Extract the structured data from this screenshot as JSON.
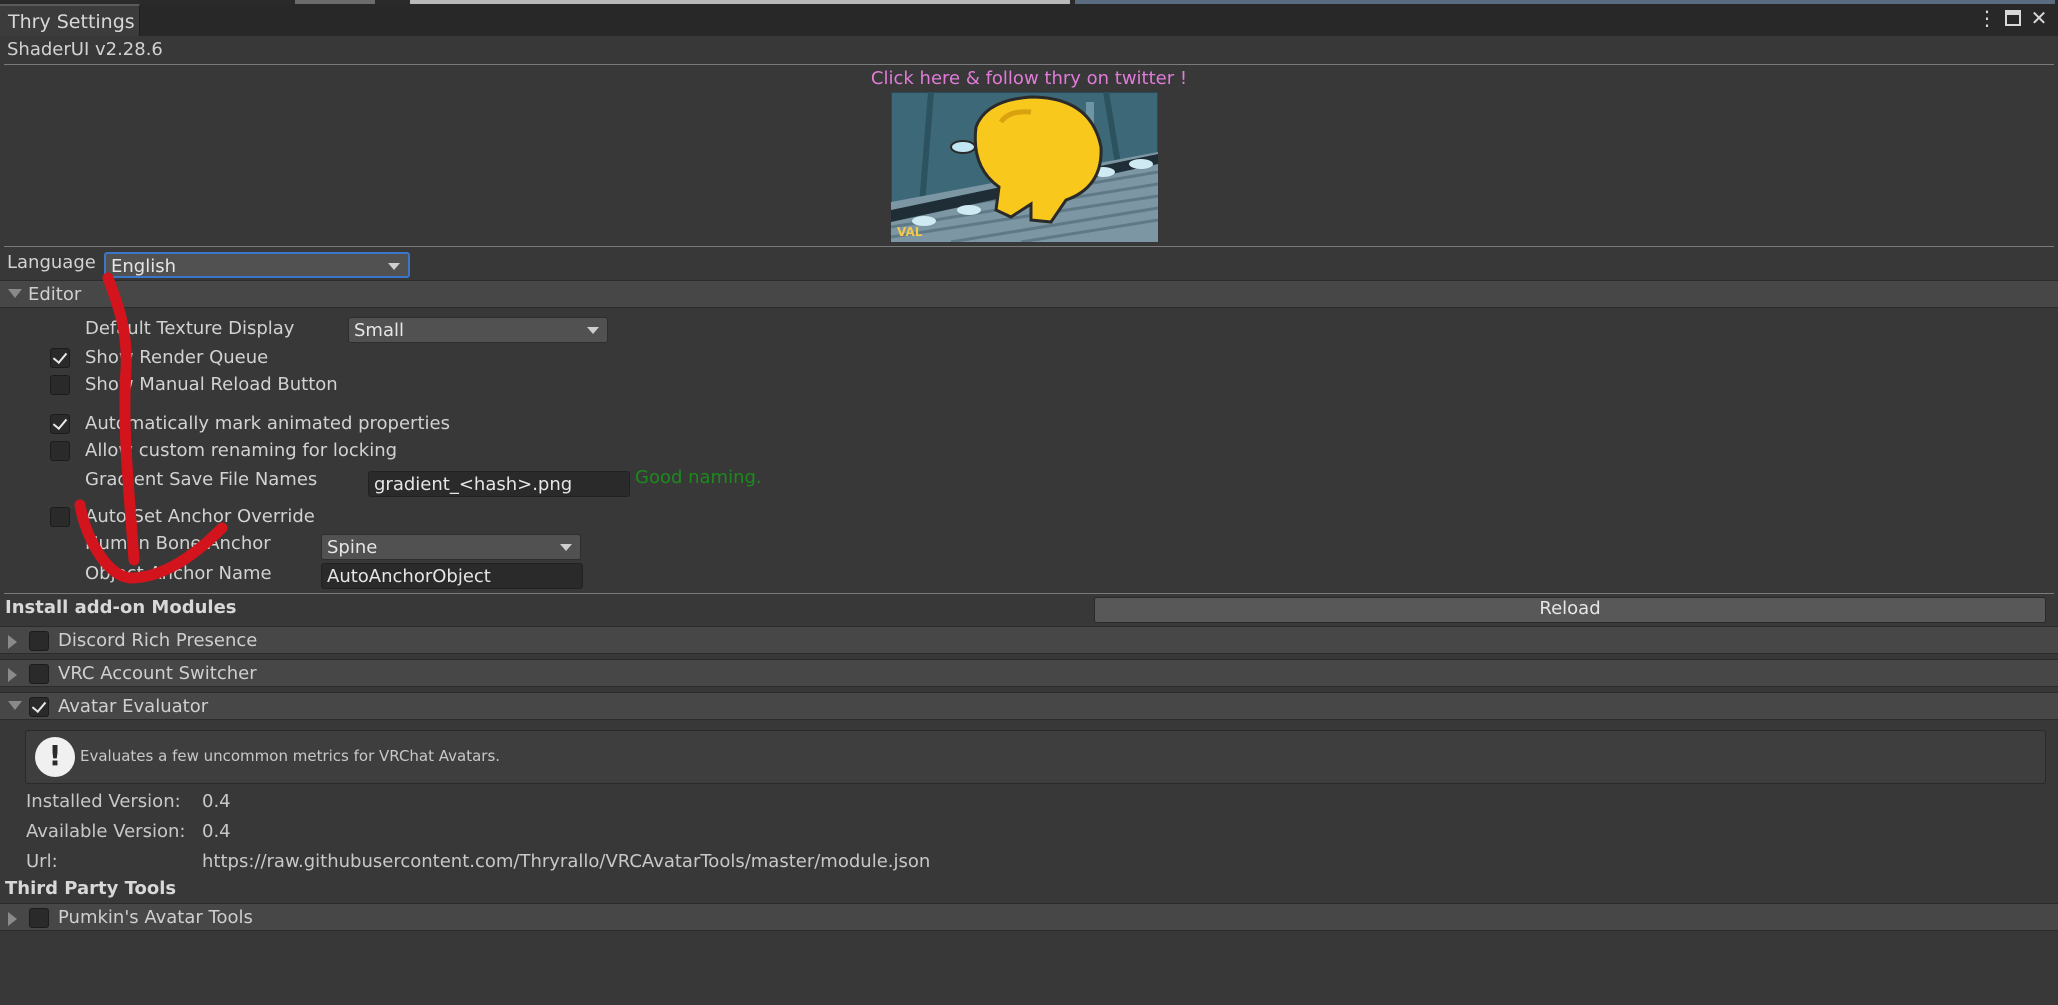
{
  "window": {
    "tab_title": "Thry Settings",
    "version": "ShaderUI v2.28.6",
    "menu_icon": "kebab-menu-icon",
    "maximize_icon": "maximize-icon",
    "close_icon": "close-icon"
  },
  "banner": {
    "twitter_link": "Click here & follow thry on twitter !",
    "watermark": "VAL"
  },
  "language": {
    "label": "Language",
    "value": "English"
  },
  "editor": {
    "header": "Editor",
    "default_texture_display": {
      "label": "Default Texture Display",
      "value": "Small"
    },
    "show_render_queue": {
      "label": "Show Render Queue",
      "checked": true
    },
    "show_manual_reload": {
      "label": "Show Manual Reload Button",
      "checked": false
    },
    "auto_mark_animated": {
      "label": "Automatically mark animated properties",
      "checked": true
    },
    "allow_custom_renaming": {
      "label": "Allow custom renaming for locking",
      "checked": false
    },
    "gradient_names": {
      "label": "Gradient Save File Names",
      "value": "gradient_<hash>.png",
      "status": "Good naming."
    },
    "auto_set_anchor": {
      "label": "Auto Set Anchor Override",
      "checked": false
    },
    "human_bone_anchor": {
      "label": "Human Bone Anchor",
      "value": "Spine"
    },
    "object_anchor_name": {
      "label": "Object Anchor Name",
      "value": "AutoAnchorObject"
    }
  },
  "modules": {
    "header": "Install add-on Modules",
    "reload": "Reload",
    "items": [
      {
        "name": "Discord Rich Presence",
        "enabled": false,
        "expanded": false
      },
      {
        "name": "VRC Account Switcher",
        "enabled": false,
        "expanded": false
      },
      {
        "name": "Avatar Evaluator",
        "enabled": true,
        "expanded": true
      }
    ],
    "evaluator": {
      "description": "Evaluates a few uncommon metrics for VRChat Avatars.",
      "installed_label": "Installed Version:",
      "installed_value": "0.4",
      "available_label": "Available Version:",
      "available_value": "0.4",
      "url_label": "Url:",
      "url_value": "https://raw.githubusercontent.com/Thryrallo/VRCAvatarTools/master/module.json"
    }
  },
  "third_party": {
    "header": "Third Party Tools",
    "items": [
      {
        "name": "Pumkin's Avatar Tools",
        "enabled": false,
        "expanded": false
      }
    ]
  },
  "colors": {
    "background": "#383838",
    "twitter": "#e07bd8",
    "good": "#1b8a1b",
    "annotation": "#d4141c",
    "focus": "#3b76c9"
  }
}
